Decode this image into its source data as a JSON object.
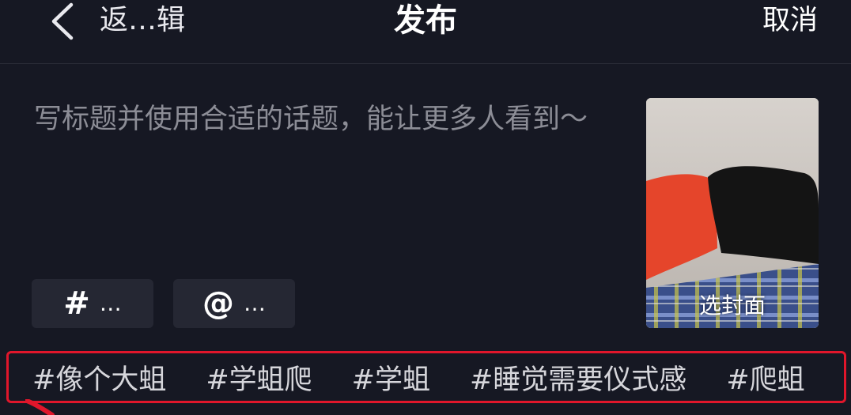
{
  "header": {
    "back_label": "返…辑",
    "title": "发布",
    "cancel_label": "取消"
  },
  "caption": {
    "placeholder": "写标题并使用合适的话题，能让更多人看到～"
  },
  "chips": {
    "hashtag_glyph": "#",
    "hashtag_dots": "…",
    "mention_glyph": "@",
    "mention_dots": "…"
  },
  "cover": {
    "label": "选封面"
  },
  "topics": [
    "#像个大蛆",
    "#学蛆爬",
    "#学蛆",
    "#睡觉需要仪式感",
    "#爬蛆"
  ],
  "colors": {
    "background": "#161823",
    "highlight_border": "#e0162b",
    "chip_bg": "#252733"
  }
}
